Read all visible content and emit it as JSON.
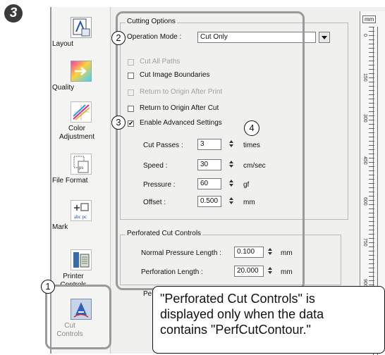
{
  "step_badge": "3",
  "sidebar": {
    "items": [
      {
        "label": "Layout"
      },
      {
        "label": "Quality"
      },
      {
        "label": "Color Adjustment"
      },
      {
        "label": "File Format"
      },
      {
        "label": "Mark"
      },
      {
        "label": "Printer Controls"
      },
      {
        "label": "Cut Controls"
      }
    ]
  },
  "cutting_options": {
    "group_title": "Cutting Options",
    "operation_mode_label": "Operation Mode :",
    "operation_mode_value": "Cut Only",
    "cut_all_paths": "Cut All Paths",
    "cut_image_boundaries": "Cut Image Boundaries",
    "return_after_print": "Return to Origin After Print",
    "return_after_cut": "Return to Origin After Cut",
    "enable_advanced": "Enable Advanced Settings",
    "enable_advanced_check": "✔",
    "cut_passes_label": "Cut Passes :",
    "cut_passes_value": "3",
    "cut_passes_unit": "times",
    "speed_label": "Speed :",
    "speed_value": "30",
    "speed_unit": "cm/sec",
    "pressure_label": "Pressure :",
    "pressure_value": "60",
    "pressure_unit": "gf",
    "offset_label": "Offset :",
    "offset_value": "0.500",
    "offset_unit": "mm"
  },
  "perforated": {
    "group_title": "Perforated Cut Controls",
    "normal_pressure_label": "Normal Pressure Length :",
    "normal_pressure_value": "0.100",
    "normal_pressure_unit": "mm",
    "perforation_label": "Perforation Length :",
    "perforation_value": "20.000",
    "perforation_unit": "mm",
    "partial_label": "Pe"
  },
  "ruler": {
    "unit": "mm",
    "labels": [
      "0",
      "150",
      "300",
      "450",
      "600",
      "750",
      "900"
    ]
  },
  "annotations": {
    "n1": "1",
    "n2": "2",
    "n3": "3",
    "n4": "4"
  },
  "callout": {
    "line1": "\"Perforated Cut Controls\" is",
    "line2": "displayed only when the data",
    "line3": "contains \"PerfCutContour.\""
  }
}
